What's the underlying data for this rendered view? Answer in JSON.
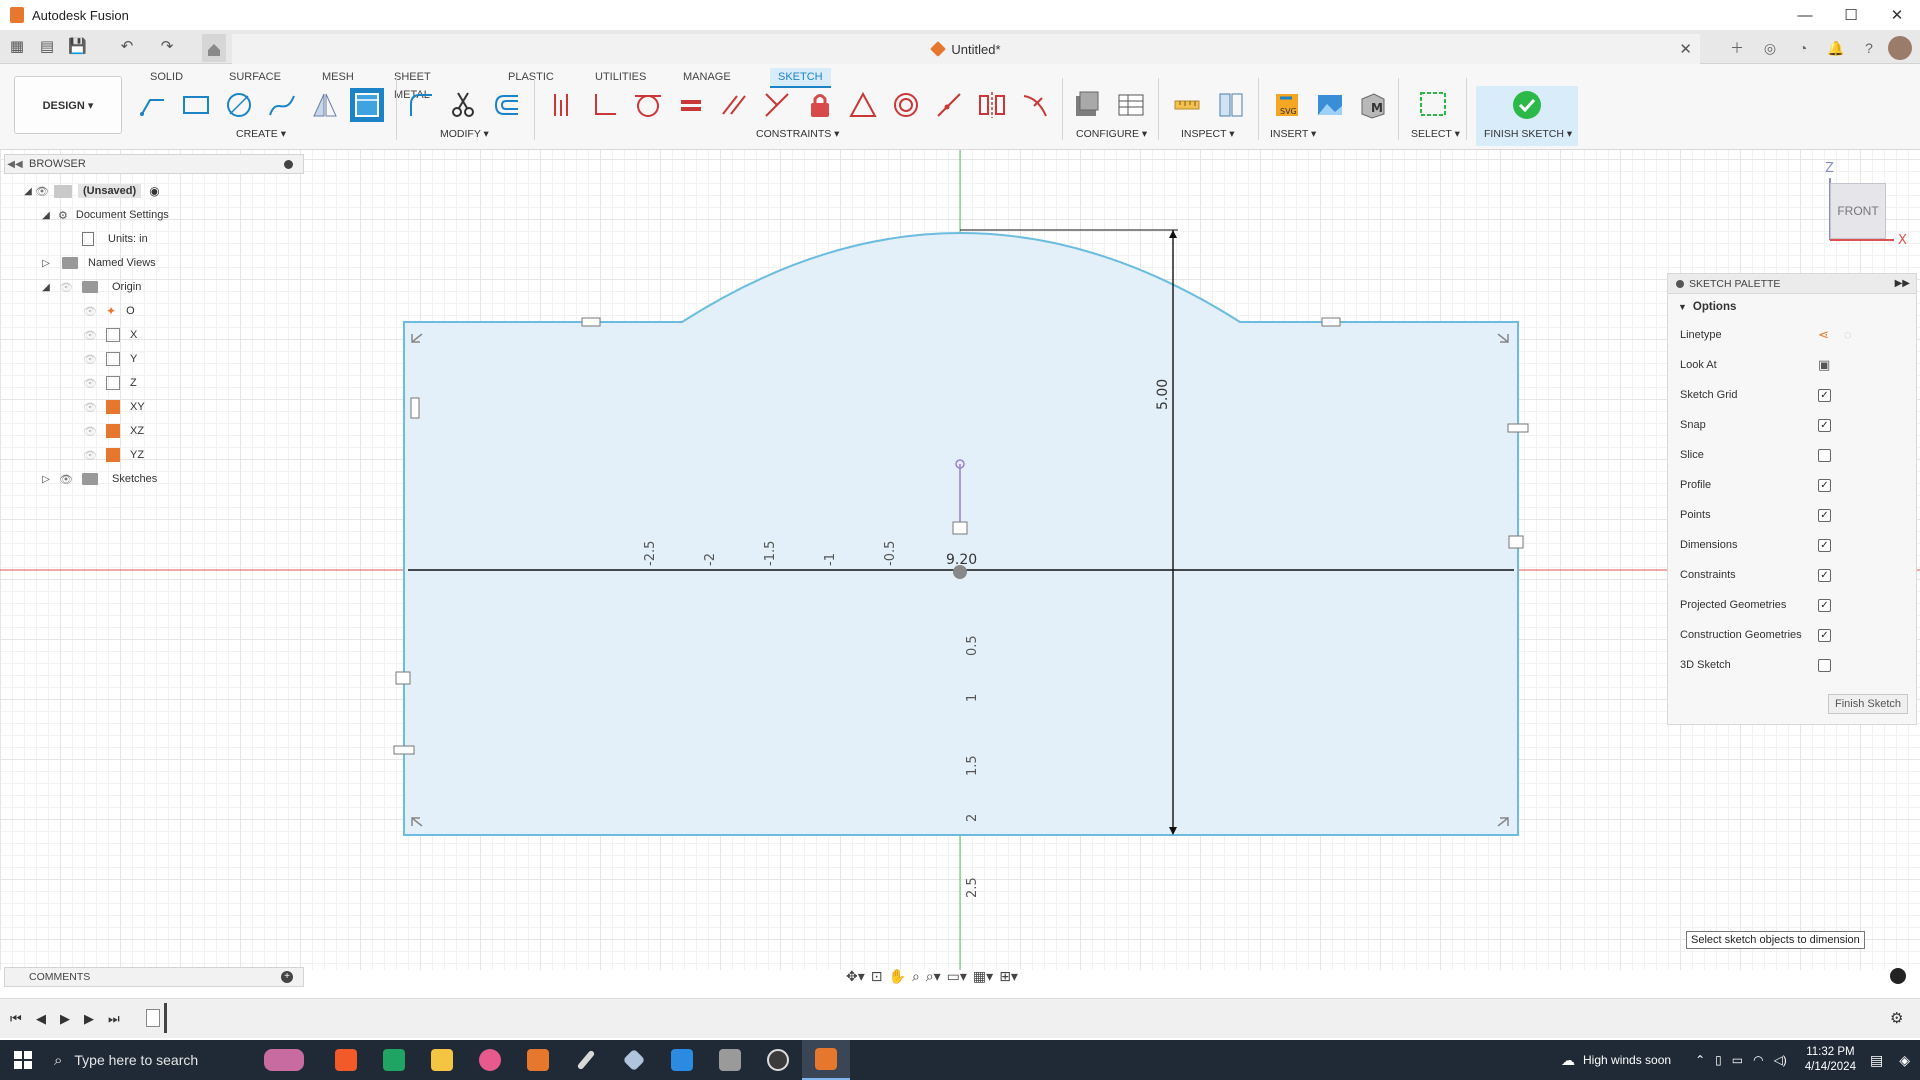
{
  "window": {
    "title": "Autodesk Fusion",
    "controls": [
      "—",
      "☐",
      "✕"
    ]
  },
  "document": {
    "title": "Untitled*"
  },
  "workspace": {
    "label": "DESIGN ▾"
  },
  "tabs": [
    "SOLID",
    "SURFACE",
    "MESH",
    "SHEET METAL",
    "PLASTIC",
    "UTILITIES",
    "MANAGE",
    "SKETCH"
  ],
  "active_tab": "SKETCH",
  "groups": {
    "create": "CREATE ▾",
    "modify": "MODIFY ▾",
    "constraints": "CONSTRAINTS ▾",
    "configure": "CONFIGURE ▾",
    "inspect": "INSPECT ▾",
    "insert": "INSERT ▾",
    "select": "SELECT ▾",
    "finish": "FINISH SKETCH ▾"
  },
  "browser": {
    "title": "BROWSER",
    "items": [
      {
        "label": "(Unsaved)"
      },
      {
        "label": "Document Settings"
      },
      {
        "label": "Units: in"
      },
      {
        "label": "Named Views"
      },
      {
        "label": "Origin"
      },
      {
        "label": "O"
      },
      {
        "label": "X"
      },
      {
        "label": "Y"
      },
      {
        "label": "Z"
      },
      {
        "label": "XY"
      },
      {
        "label": "XZ"
      },
      {
        "label": "YZ"
      },
      {
        "label": "Sketches"
      }
    ]
  },
  "sketch": {
    "dimension_height": "5.00",
    "dimension_width": "9.20",
    "ruler_h_neg": [
      "-2.5",
      "-2",
      "-1.5",
      "-1",
      "-0.5"
    ],
    "ruler_v_pos": [
      "0.5",
      "1",
      "1.5",
      "2",
      "2.5"
    ]
  },
  "viewcube": {
    "face": "FRONT",
    "axis_z": "Z",
    "axis_x": "X"
  },
  "palette": {
    "title": "SKETCH PALETTE",
    "section": "Options",
    "rows": [
      {
        "label": "Linetype",
        "type": "icon"
      },
      {
        "label": "Look At",
        "type": "icon"
      },
      {
        "label": "Sketch Grid",
        "checked": true
      },
      {
        "label": "Snap",
        "checked": true
      },
      {
        "label": "Slice",
        "checked": false
      },
      {
        "label": "Profile",
        "checked": true
      },
      {
        "label": "Points",
        "checked": true
      },
      {
        "label": "Dimensions",
        "checked": true
      },
      {
        "label": "Constraints",
        "checked": true
      },
      {
        "label": "Projected Geometries",
        "checked": true
      },
      {
        "label": "Construction Geometries",
        "checked": true
      },
      {
        "label": "3D Sketch",
        "checked": false
      }
    ],
    "finish_button": "Finish Sketch"
  },
  "tooltip": "Select sketch objects to dimension",
  "comments": {
    "label": "COMMENTS"
  },
  "taskbar": {
    "search_placeholder": "Type here to search",
    "weather": "High winds soon",
    "time": "11:32 PM",
    "date": "4/14/2024"
  },
  "colors": {
    "accent": "#1b83c6",
    "profile_fill": "#e3f0f9",
    "sketch_line": "#6cbcdf",
    "x_axis": "#e05050",
    "z_axis": "#58c058",
    "finish_green": "#2db84a"
  }
}
